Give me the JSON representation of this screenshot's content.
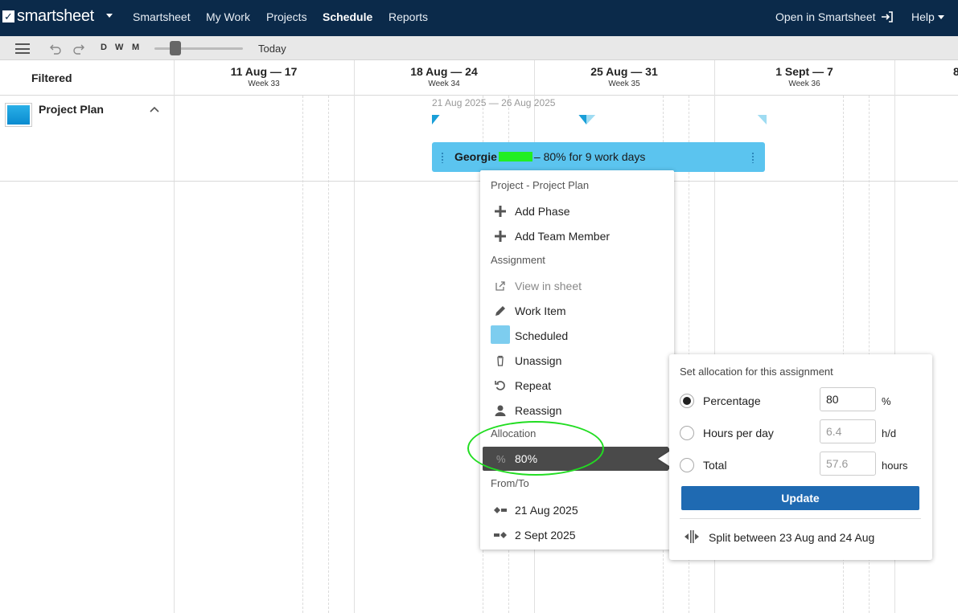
{
  "app": {
    "logo_text": "smartsheet",
    "nav": [
      "Smartsheet",
      "My Work",
      "Projects",
      "Schedule",
      "Reports"
    ],
    "active_nav": "Schedule",
    "open_in": "Open in Smartsheet",
    "help": "Help"
  },
  "toolbar": {
    "zoom_levels": [
      "D",
      "W",
      "M"
    ],
    "today_label": "Today"
  },
  "grid": {
    "filter_label": "Filtered",
    "weeks": [
      {
        "range": "11 Aug — 17",
        "week": "Week 33"
      },
      {
        "range": "18 Aug — 24",
        "week": "Week 34"
      },
      {
        "range": "25 Aug — 31",
        "week": "Week 35"
      },
      {
        "range": "1 Sept — 7",
        "week": "Week 36"
      },
      {
        "range": "8",
        "week": ""
      }
    ]
  },
  "project": {
    "name": "Project Plan",
    "phase_dates": "21 Aug 2025 — 26 Aug 2025",
    "assignee": "Georgie",
    "assignment_summary": "– 80% for 9 work days",
    "colors": {
      "phase_dark": "#1a9fd8",
      "phase_light": "#9fdcf2",
      "assignment": "#5bc4ef"
    }
  },
  "context_menu": {
    "project_header": "Project - Project Plan",
    "add_phase": "Add Phase",
    "add_team_member": "Add Team Member",
    "assignment_header": "Assignment",
    "view_in_sheet": "View in sheet",
    "work_item": "Work Item",
    "scheduled": "Scheduled",
    "unassign": "Unassign",
    "repeat": "Repeat",
    "reassign": "Reassign",
    "allocation_header": "Allocation",
    "allocation_symbol": "%",
    "allocation_value": "80%",
    "from_to_header": "From/To",
    "from_date": "21 Aug 2025",
    "to_date": "2 Sept 2025"
  },
  "allocation_popover": {
    "title": "Set allocation for this assignment",
    "options": [
      {
        "label": "Percentage",
        "value": "80",
        "unit": "%",
        "selected": true
      },
      {
        "label": "Hours per day",
        "value": "6.4",
        "unit": "h/d",
        "selected": false
      },
      {
        "label": "Total",
        "value": "57.6",
        "unit": "hours",
        "selected": false
      }
    ],
    "update_label": "Update",
    "split_label": "Split between 23 Aug and 24 Aug",
    "accent": "#1f6ab2"
  }
}
